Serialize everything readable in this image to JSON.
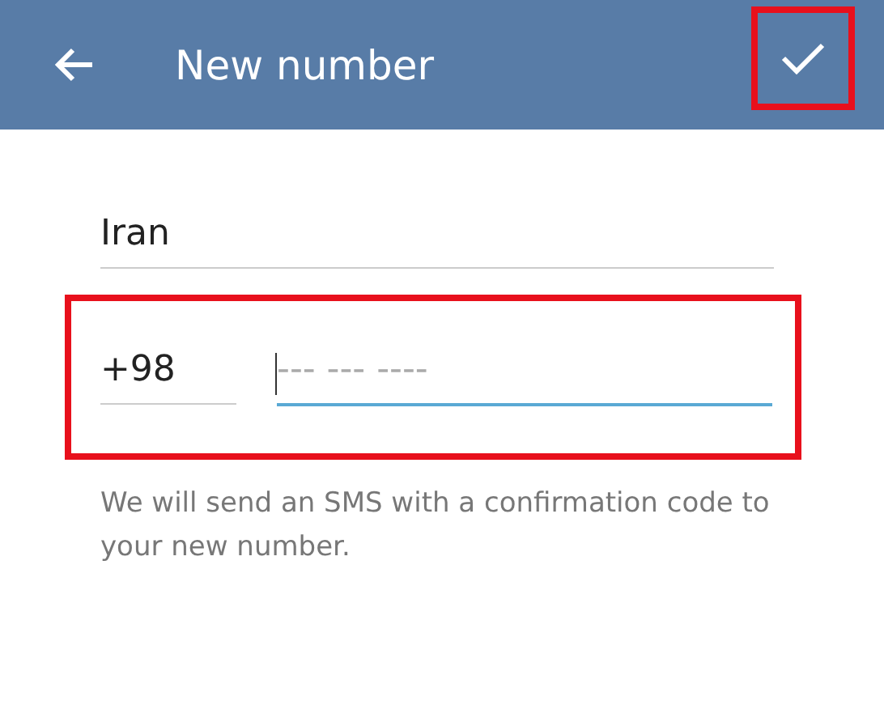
{
  "header": {
    "title": "New number"
  },
  "country": {
    "value": "Iran"
  },
  "phone": {
    "code": "+98",
    "placeholder": "--- --- ----",
    "focused": true
  },
  "hint": "We will send an SMS with a confirmation code to your new number.",
  "highlights": {
    "done_button": true,
    "phone_row": true
  }
}
